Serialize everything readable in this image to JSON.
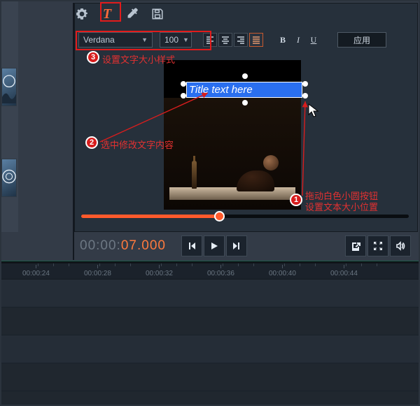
{
  "toolbar": {
    "icons": {
      "settings": "gear",
      "text": "T",
      "eyedropper": "eyedropper",
      "save": "save"
    },
    "font_family": "Verdana",
    "font_size": "100",
    "align": {
      "left": "左对齐",
      "center": "居中",
      "right": "右对齐",
      "justify": "两端"
    },
    "format": {
      "bold": "B",
      "italic": "I",
      "underline": "U"
    },
    "apply": "应用"
  },
  "canvas": {
    "title_text": "Title text here"
  },
  "annotations": {
    "b1": {
      "num": "1",
      "text_a": "拖动白色小圆按钮",
      "text_b": "设置文本大小位置"
    },
    "b2": {
      "num": "2",
      "text": "选中修改文字内容"
    },
    "b3": {
      "num": "3",
      "text": "设置文字大小样式"
    }
  },
  "player": {
    "timecode_gray": "00:00:",
    "timecode_sec": "07",
    "timecode_ms": ".000",
    "progress_ratio": 0.42
  },
  "ruler": {
    "ticks": [
      "00:00:24",
      "00:00:28",
      "00:00:32",
      "00:00:36",
      "00:00:40",
      "00:00:44"
    ]
  }
}
